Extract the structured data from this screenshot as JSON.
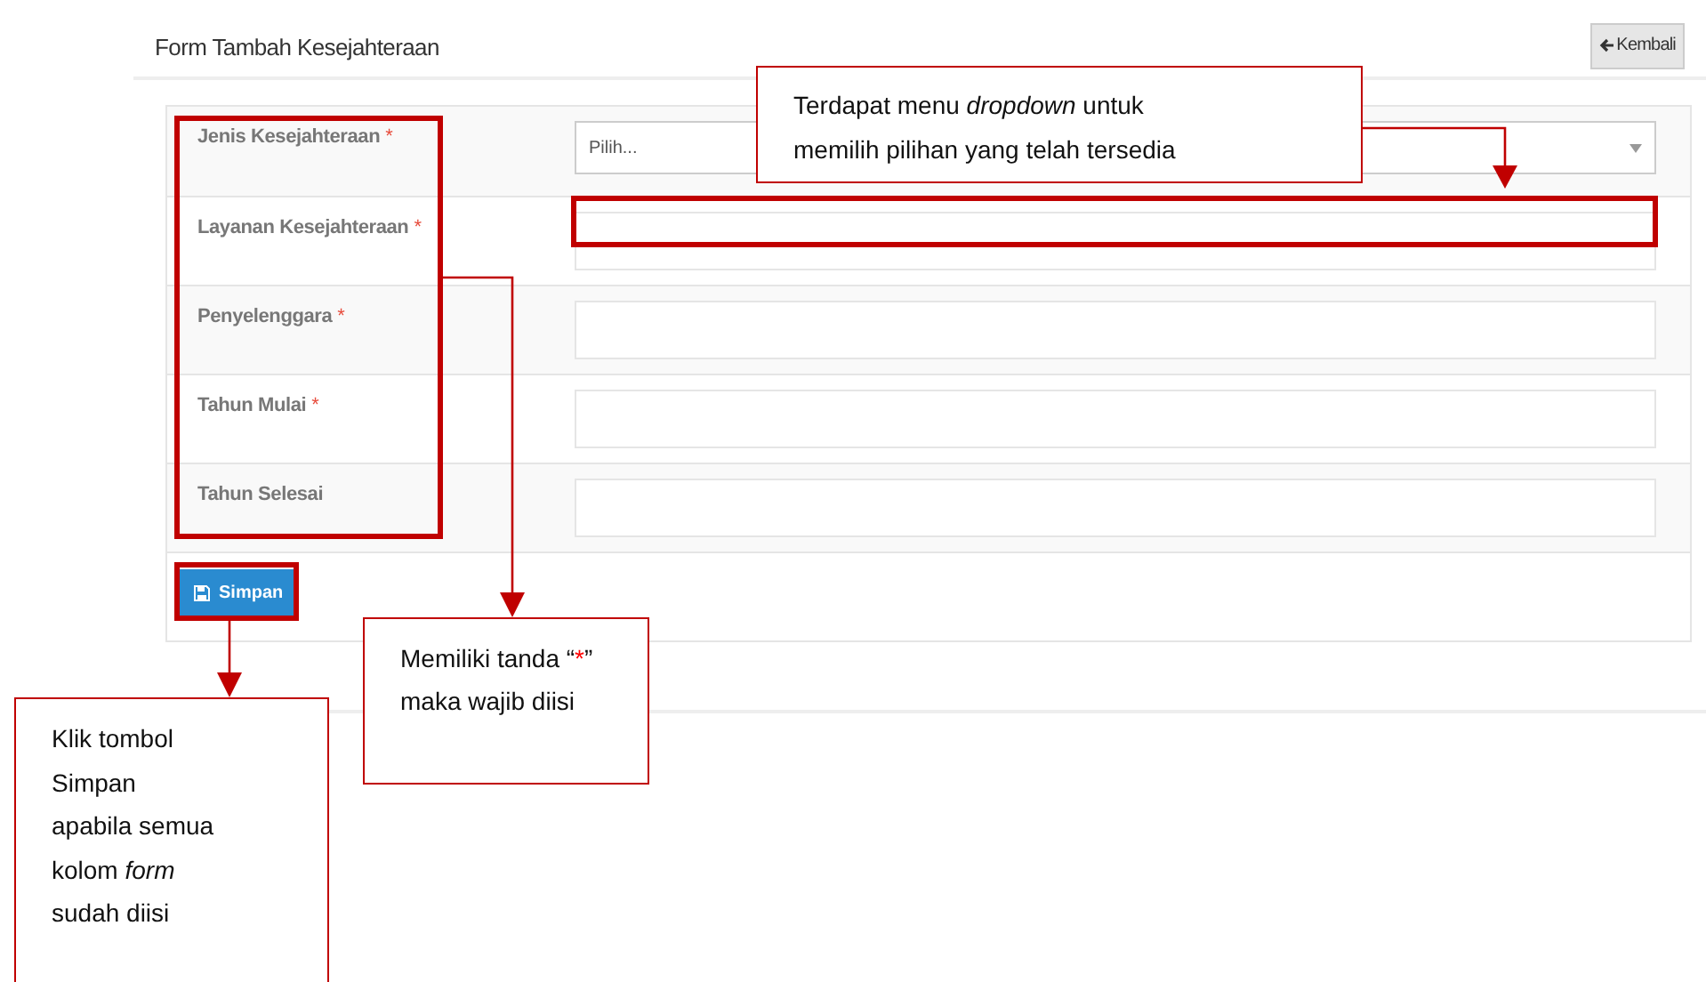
{
  "header": {
    "title": "Form Tambah Kesejahteraan",
    "back_button": "Kembali"
  },
  "form": {
    "fields": [
      {
        "kind": "select",
        "label": "Jenis Kesejahteraan",
        "mark": "*",
        "placeholder": "Pilih..."
      },
      {
        "kind": "text",
        "label": "Layanan Kesejahteraan",
        "mark": "*"
      },
      {
        "kind": "text",
        "label": "Penyelenggara",
        "mark": "*"
      },
      {
        "kind": "text",
        "label": "Tahun Mulai",
        "mark": "*"
      },
      {
        "kind": "text",
        "label": "Tahun Selesai"
      }
    ],
    "submit": "Simpan"
  },
  "callouts": [
    {
      "kind": "dropdown",
      "text": "Terdapat menu *dropdown* untuk memilih pilihan yang telah tersedia"
    },
    {
      "kind": "required",
      "before": "Memiliki tanda “",
      "mark": "*",
      "after": "” maka wajib diisi"
    },
    {
      "kind": "save",
      "text": "Klik tombol\nSimpan\napabila semua\nkolom *form*\nsudah diisi"
    }
  ]
}
